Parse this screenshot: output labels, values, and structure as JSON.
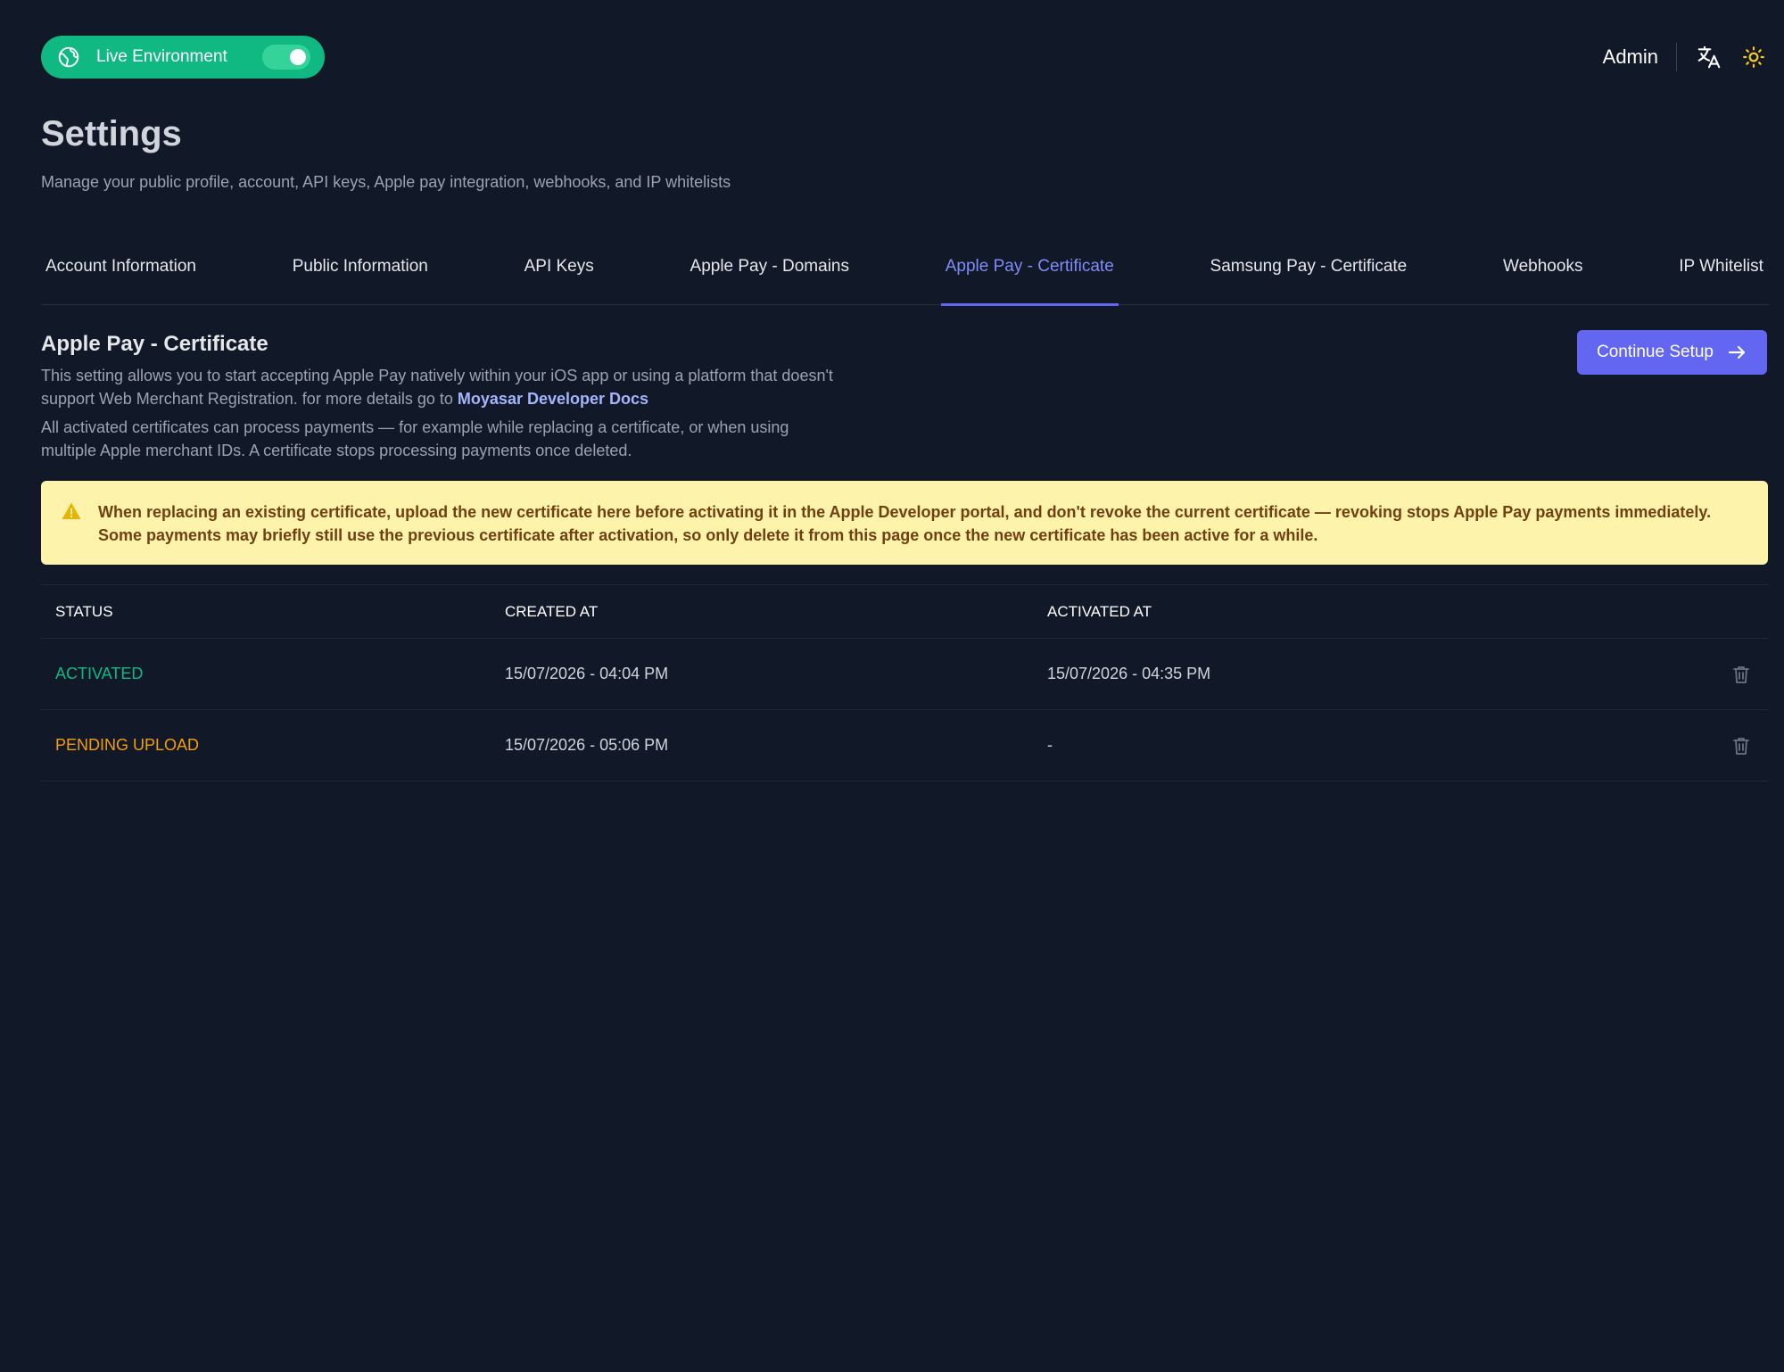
{
  "environment": {
    "label": "Live Environment",
    "enabled": true
  },
  "header_right": {
    "user": "Admin",
    "icons": [
      "translate-icon",
      "sun-icon"
    ]
  },
  "page": {
    "title": "Settings",
    "subtitle": "Manage your public profile, account, API keys, Apple pay integration, webhooks, and IP whitelists"
  },
  "tabs": [
    {
      "label": "Account Information",
      "active": false
    },
    {
      "label": "Public Information",
      "active": false
    },
    {
      "label": "API Keys",
      "active": false
    },
    {
      "label": "Apple Pay - Domains",
      "active": false
    },
    {
      "label": "Apple Pay - Certificate",
      "active": true
    },
    {
      "label": "Samsung Pay - Certificate",
      "active": false
    },
    {
      "label": "Webhooks",
      "active": false
    },
    {
      "label": "IP Whitelist",
      "active": false
    }
  ],
  "section": {
    "title": "Apple Pay - Certificate",
    "desc_1": "This setting allows you to start accepting Apple Pay natively within your iOS app or using a platform that doesn't support Web Merchant Registration. for more details go to",
    "docs_link": "Moyasar Developer Docs",
    "desc_2": "All activated certificates can process payments — for example while replacing a certificate, or when using multiple Apple merchant IDs. A certificate stops processing payments once deleted.",
    "continue_label": "Continue Setup"
  },
  "warning": {
    "text": "When replacing an existing certificate, upload the new certificate here before activating it in the Apple Developer portal, and don't revoke the current certificate — revoking stops Apple Pay payments immediately. Some payments may briefly still use the previous certificate after activation, so only delete it from this page once the new certificate has been active for a while."
  },
  "table": {
    "columns": [
      "STATUS",
      "CREATED AT",
      "ACTIVATED AT"
    ],
    "rows": [
      {
        "status": "ACTIVATED",
        "created_at": "15/07/2026 - 04:04 PM",
        "activated_at": "15/07/2026 - 04:35 PM"
      },
      {
        "status": "PENDING UPLOAD",
        "created_at": "15/07/2026 - 05:06 PM",
        "activated_at": "-"
      }
    ]
  },
  "colors": {
    "background": "#111827",
    "accent": "#6366f1",
    "live": "#10b981",
    "activated": "#10b981",
    "pending": "#f59e0b",
    "warning_bg": "#fef3aa"
  }
}
